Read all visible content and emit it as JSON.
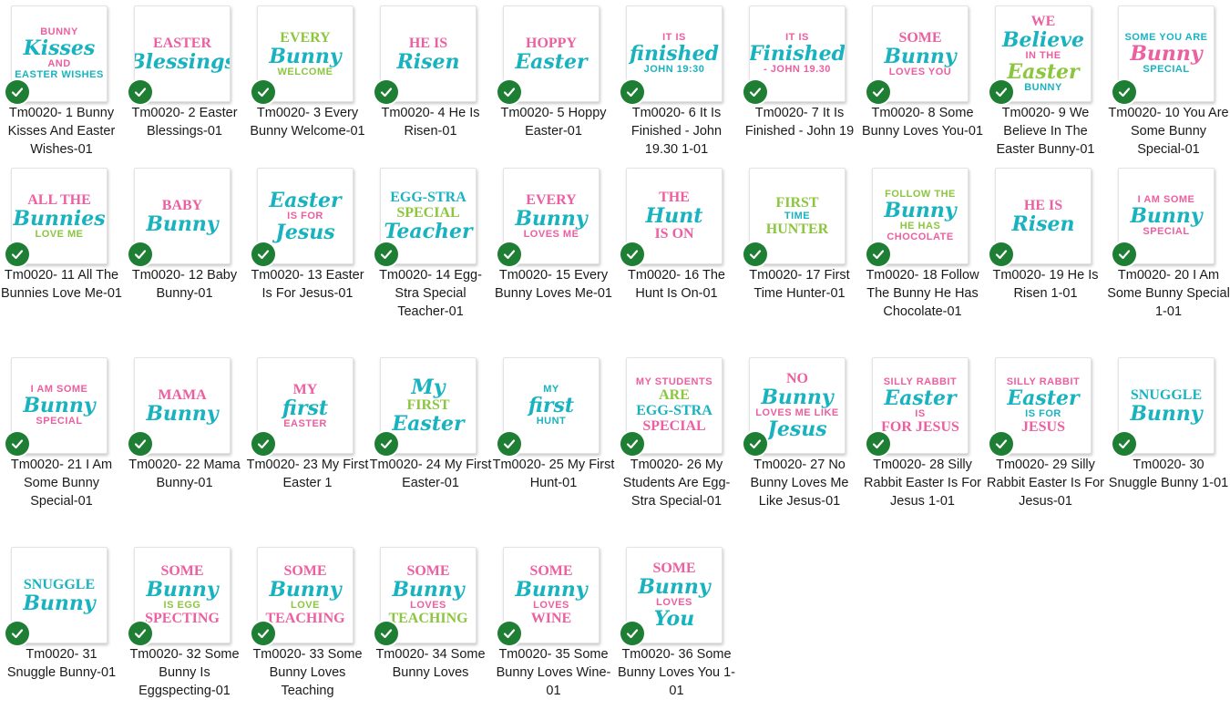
{
  "files": [
    {
      "name": "Tm0020- 1 Bunny Kisses And Easter Wishes-01",
      "art": [
        {
          "t": "BUNNY",
          "s": "sm",
          "c": "pink"
        },
        {
          "t": "Kisses",
          "s": "lg",
          "c": "teal"
        },
        {
          "t": "AND",
          "s": "sm",
          "c": "pink"
        },
        {
          "t": "EASTER WISHES",
          "s": "sm",
          "c": "teal"
        }
      ]
    },
    {
      "name": "Tm0020- 2 Easter Blessings-01",
      "art": [
        {
          "t": "EASTER",
          "s": "md",
          "c": "pink"
        },
        {
          "t": "Blessings",
          "s": "lg",
          "c": "teal"
        }
      ]
    },
    {
      "name": "Tm0020- 3 Every Bunny Welcome-01",
      "art": [
        {
          "t": "EVERY",
          "s": "md",
          "c": "green"
        },
        {
          "t": "Bunny",
          "s": "lg",
          "c": "teal"
        },
        {
          "t": "WELCOME",
          "s": "sm",
          "c": "green"
        }
      ]
    },
    {
      "name": "Tm0020- 4 He Is Risen-01",
      "art": [
        {
          "t": "HE IS",
          "s": "md",
          "c": "pink"
        },
        {
          "t": "Risen",
          "s": "lg",
          "c": "teal"
        }
      ]
    },
    {
      "name": "Tm0020- 5 Hoppy Easter-01",
      "art": [
        {
          "t": "HOPPY",
          "s": "md",
          "c": "pink"
        },
        {
          "t": "Easter",
          "s": "lg",
          "c": "teal"
        }
      ]
    },
    {
      "name": "Tm0020- 6 It Is Finished - John 19.30   1-01",
      "art": [
        {
          "t": "IT IS",
          "s": "sm",
          "c": "pink"
        },
        {
          "t": "finished",
          "s": "lg",
          "c": "teal"
        },
        {
          "t": "JOHN 19:30",
          "s": "sm",
          "c": "teal"
        }
      ]
    },
    {
      "name": "Tm0020- 7 It Is Finished - John 19",
      "art": [
        {
          "t": "IT IS",
          "s": "sm",
          "c": "pink"
        },
        {
          "t": "Finished",
          "s": "lg",
          "c": "teal"
        },
        {
          "t": "- JOHN 19.30",
          "s": "sm",
          "c": "pink"
        }
      ]
    },
    {
      "name": "Tm0020- 8 Some Bunny Loves You-01",
      "art": [
        {
          "t": "SOME",
          "s": "md",
          "c": "pink"
        },
        {
          "t": "Bunny",
          "s": "lg",
          "c": "teal"
        },
        {
          "t": "LOVES YOU",
          "s": "sm",
          "c": "pink"
        }
      ]
    },
    {
      "name": "Tm0020- 9 We Believe In The Easter Bunny-01",
      "art": [
        {
          "t": "WE",
          "s": "md",
          "c": "pink"
        },
        {
          "t": "Believe",
          "s": "lg",
          "c": "teal"
        },
        {
          "t": "IN THE",
          "s": "sm",
          "c": "pink"
        },
        {
          "t": "Easter",
          "s": "lg",
          "c": "green"
        },
        {
          "t": "BUNNY",
          "s": "sm",
          "c": "teal"
        }
      ]
    },
    {
      "name": "Tm0020- 10 You Are Some Bunny Special-01",
      "art": [
        {
          "t": "SOME YOU ARE",
          "s": "sm",
          "c": "teal"
        },
        {
          "t": "Bunny",
          "s": "lg",
          "c": "pink"
        },
        {
          "t": "SPECIAL",
          "s": "sm",
          "c": "teal"
        }
      ]
    },
    {
      "name": "Tm0020- 11 All The Bunnies Love Me-01",
      "art": [
        {
          "t": "ALL THE",
          "s": "md",
          "c": "pink"
        },
        {
          "t": "Bunnies",
          "s": "lg",
          "c": "teal"
        },
        {
          "t": "LOVE ME",
          "s": "sm",
          "c": "green"
        }
      ]
    },
    {
      "name": "Tm0020- 12 Baby Bunny-01",
      "art": [
        {
          "t": "BABY",
          "s": "md",
          "c": "pink"
        },
        {
          "t": "Bunny",
          "s": "lg",
          "c": "teal"
        }
      ]
    },
    {
      "name": "Tm0020- 13 Easter Is For Jesus-01",
      "art": [
        {
          "t": "Easter",
          "s": "lg",
          "c": "teal"
        },
        {
          "t": "IS FOR",
          "s": "sm",
          "c": "pink"
        },
        {
          "t": "Jesus",
          "s": "lg",
          "c": "teal"
        }
      ]
    },
    {
      "name": "Tm0020- 14 Egg-Stra Special Teacher-01",
      "art": [
        {
          "t": "EGG-STRA",
          "s": "md",
          "c": "teal"
        },
        {
          "t": "SPECIAL",
          "s": "md",
          "c": "green"
        },
        {
          "t": "Teacher",
          "s": "lg",
          "c": "teal"
        }
      ]
    },
    {
      "name": "Tm0020- 15 Every Bunny Loves Me-01",
      "art": [
        {
          "t": "EVERY",
          "s": "md",
          "c": "pink"
        },
        {
          "t": "Bunny",
          "s": "lg",
          "c": "teal"
        },
        {
          "t": "LOVES ME",
          "s": "sm",
          "c": "pink"
        }
      ]
    },
    {
      "name": "Tm0020- 16 The Hunt Is On-01",
      "art": [
        {
          "t": "THE",
          "s": "md",
          "c": "pink"
        },
        {
          "t": "Hunt",
          "s": "lg",
          "c": "teal"
        },
        {
          "t": "IS ON",
          "s": "md",
          "c": "pink"
        }
      ]
    },
    {
      "name": "Tm0020- 17 First Time Hunter-01",
      "art": [
        {
          "t": "FIRST",
          "s": "md",
          "c": "green"
        },
        {
          "t": "TIME",
          "s": "sm",
          "c": "teal"
        },
        {
          "t": "HUNTER",
          "s": "md",
          "c": "green"
        }
      ]
    },
    {
      "name": "Tm0020- 18 Follow The Bunny He Has Chocolate-01",
      "art": [
        {
          "t": "FOLLOW THE",
          "s": "sm",
          "c": "green"
        },
        {
          "t": "Bunny",
          "s": "lg",
          "c": "teal"
        },
        {
          "t": "HE HAS",
          "s": "sm",
          "c": "green"
        },
        {
          "t": "CHOCOLATE",
          "s": "sm",
          "c": "pink"
        }
      ]
    },
    {
      "name": "Tm0020- 19 He Is Risen 1-01",
      "art": [
        {
          "t": "HE IS",
          "s": "md",
          "c": "pink"
        },
        {
          "t": "Risen",
          "s": "lg",
          "c": "teal"
        }
      ]
    },
    {
      "name": "Tm0020- 20 I Am Some Bunny Special 1-01",
      "art": [
        {
          "t": "I AM SOME",
          "s": "sm",
          "c": "pink"
        },
        {
          "t": "Bunny",
          "s": "lg",
          "c": "teal"
        },
        {
          "t": "SPECIAL",
          "s": "sm",
          "c": "pink"
        }
      ]
    },
    {
      "name": "Tm0020- 21 I Am Some Bunny Special-01",
      "art": [
        {
          "t": "I AM SOME",
          "s": "sm",
          "c": "pink"
        },
        {
          "t": "Bunny",
          "s": "lg",
          "c": "teal"
        },
        {
          "t": "SPECIAL",
          "s": "sm",
          "c": "pink"
        }
      ]
    },
    {
      "name": "Tm0020- 22 Mama Bunny-01",
      "art": [
        {
          "t": "MAMA",
          "s": "md",
          "c": "pink"
        },
        {
          "t": "Bunny",
          "s": "lg",
          "c": "teal"
        }
      ]
    },
    {
      "name": "Tm0020- 23 My First Easter 1",
      "art": [
        {
          "t": "MY",
          "s": "md",
          "c": "pink"
        },
        {
          "t": "first",
          "s": "lg",
          "c": "teal"
        },
        {
          "t": "EASTER",
          "s": "sm",
          "c": "pink"
        }
      ]
    },
    {
      "name": "Tm0020- 24 My First Easter-01",
      "art": [
        {
          "t": "My",
          "s": "lg",
          "c": "teal"
        },
        {
          "t": "FIRST",
          "s": "md",
          "c": "green"
        },
        {
          "t": "Easter",
          "s": "lg",
          "c": "teal"
        }
      ]
    },
    {
      "name": "Tm0020- 25 My First Hunt-01",
      "art": [
        {
          "t": "MY",
          "s": "sm",
          "c": "teal"
        },
        {
          "t": "first",
          "s": "lg",
          "c": "teal"
        },
        {
          "t": "HUNT",
          "s": "sm",
          "c": "teal"
        }
      ]
    },
    {
      "name": "Tm0020- 26 My Students Are Egg-Stra Special-01",
      "art": [
        {
          "t": "MY STUDENTS",
          "s": "sm",
          "c": "pink"
        },
        {
          "t": "ARE",
          "s": "md",
          "c": "green"
        },
        {
          "t": "EGG-STRA",
          "s": "md",
          "c": "teal"
        },
        {
          "t": "SPECIAL",
          "s": "md",
          "c": "pink"
        }
      ]
    },
    {
      "name": "Tm0020- 27 No Bunny Loves Me Like Jesus-01",
      "art": [
        {
          "t": "NO",
          "s": "md",
          "c": "pink"
        },
        {
          "t": "Bunny",
          "s": "lg",
          "c": "teal"
        },
        {
          "t": "LOVES ME LIKE",
          "s": "sm",
          "c": "pink"
        },
        {
          "t": "Jesus",
          "s": "lg",
          "c": "teal"
        }
      ]
    },
    {
      "name": "Tm0020- 28 Silly Rabbit Easter Is For Jesus 1-01",
      "art": [
        {
          "t": "SILLY RABBIT",
          "s": "sm",
          "c": "pink"
        },
        {
          "t": "Easter",
          "s": "lg",
          "c": "teal"
        },
        {
          "t": "IS",
          "s": "sm",
          "c": "pink"
        },
        {
          "t": "FOR JESUS",
          "s": "md",
          "c": "pink"
        }
      ]
    },
    {
      "name": "Tm0020- 29 Silly Rabbit Easter Is For Jesus-01",
      "art": [
        {
          "t": "SILLY RABBIT",
          "s": "sm",
          "c": "pink"
        },
        {
          "t": "Easter",
          "s": "lg",
          "c": "teal"
        },
        {
          "t": "IS FOR",
          "s": "sm",
          "c": "teal"
        },
        {
          "t": "JESUS",
          "s": "md",
          "c": "pink"
        }
      ]
    },
    {
      "name": "Tm0020- 30 Snuggle Bunny 1-01",
      "art": [
        {
          "t": "SNUGGLE",
          "s": "md",
          "c": "teal"
        },
        {
          "t": "Bunny",
          "s": "lg",
          "c": "teal"
        }
      ]
    },
    {
      "name": "Tm0020- 31 Snuggle Bunny-01",
      "art": [
        {
          "t": "SNUGGLE",
          "s": "md",
          "c": "teal"
        },
        {
          "t": "Bunny",
          "s": "lg",
          "c": "teal"
        }
      ]
    },
    {
      "name": "Tm0020- 32 Some Bunny Is Eggspecting-01",
      "art": [
        {
          "t": "SOME",
          "s": "md",
          "c": "pink"
        },
        {
          "t": "Bunny",
          "s": "lg",
          "c": "teal"
        },
        {
          "t": "IS EGG",
          "s": "sm",
          "c": "green"
        },
        {
          "t": "SPECTING",
          "s": "md",
          "c": "pink"
        }
      ]
    },
    {
      "name": "Tm0020- 33 Some Bunny Loves Teaching",
      "art": [
        {
          "t": "SOME",
          "s": "md",
          "c": "pink"
        },
        {
          "t": "Bunny",
          "s": "lg",
          "c": "teal"
        },
        {
          "t": "LOVE",
          "s": "sm",
          "c": "green"
        },
        {
          "t": "TEACHING",
          "s": "md",
          "c": "pink"
        }
      ]
    },
    {
      "name": "Tm0020- 34 Some Bunny Loves",
      "art": [
        {
          "t": "SOME",
          "s": "md",
          "c": "pink"
        },
        {
          "t": "Bunny",
          "s": "lg",
          "c": "teal"
        },
        {
          "t": "LOVES",
          "s": "sm",
          "c": "pink"
        },
        {
          "t": "TEACHING",
          "s": "md",
          "c": "green"
        }
      ]
    },
    {
      "name": "Tm0020- 35 Some Bunny Loves Wine-01",
      "art": [
        {
          "t": "SOME",
          "s": "md",
          "c": "pink"
        },
        {
          "t": "Bunny",
          "s": "lg",
          "c": "teal"
        },
        {
          "t": "LOVES",
          "s": "sm",
          "c": "pink"
        },
        {
          "t": "WINE",
          "s": "md",
          "c": "pink"
        }
      ]
    },
    {
      "name": "Tm0020- 36 Some Bunny Loves You 1-01",
      "art": [
        {
          "t": "SOME",
          "s": "md",
          "c": "pink"
        },
        {
          "t": "Bunny",
          "s": "lg",
          "c": "teal"
        },
        {
          "t": "LOVES",
          "s": "sm",
          "c": "pink"
        },
        {
          "t": "You",
          "s": "lg",
          "c": "teal"
        }
      ]
    }
  ],
  "icons": {
    "selected": "checkmark-icon"
  },
  "colors": {
    "teal": "#19b3c0",
    "pink": "#ec5fa0",
    "green": "#8cc63f",
    "check": "#1e7e34"
  }
}
